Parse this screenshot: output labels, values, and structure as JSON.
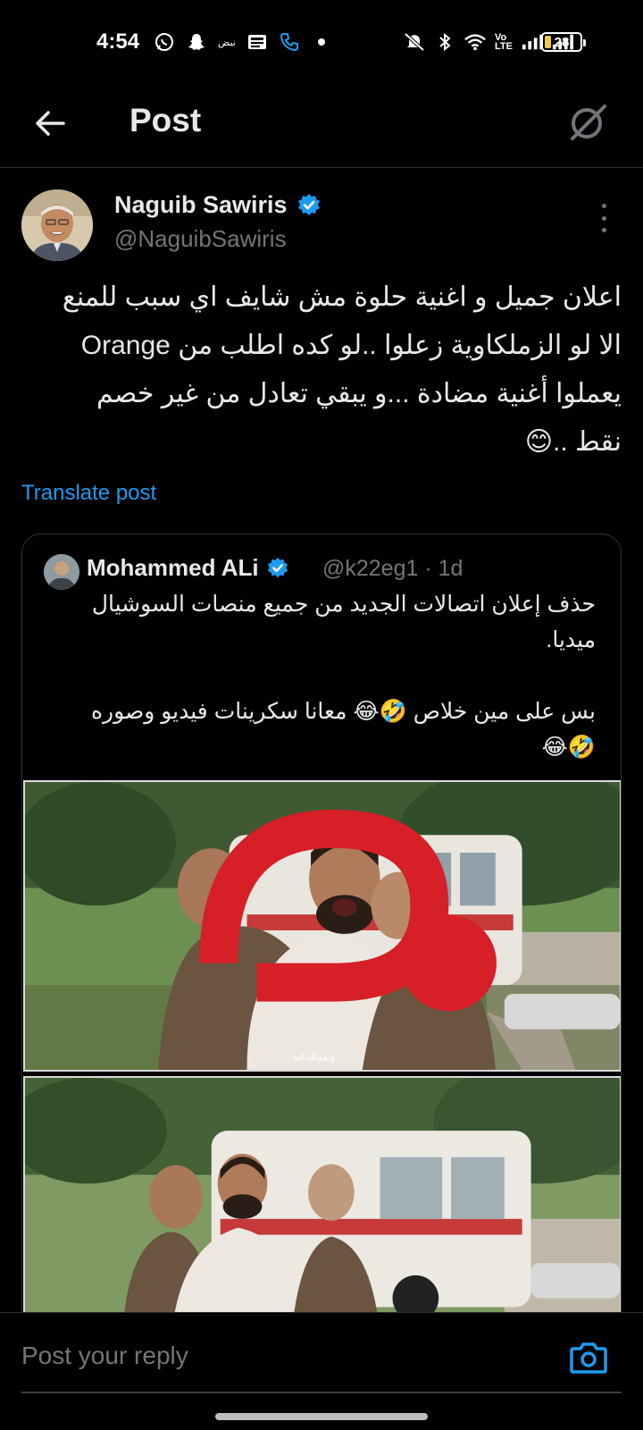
{
  "status_bar": {
    "time": "4:54",
    "carrier_label": "نبض",
    "volte_label": "Vo LTE",
    "battery_level": "28",
    "icons": [
      "whatsapp-icon",
      "snapchat-icon",
      "news-icon",
      "phone-icon",
      "dot-icon",
      "mute-icon",
      "bluetooth-icon",
      "wifi-icon",
      "signal-icon",
      "signal-icon",
      "battery-icon"
    ]
  },
  "header": {
    "title": "Post",
    "back_icon": "arrow-left-icon",
    "grok_icon": "grok-icon"
  },
  "post": {
    "author_name": "Naguib Sawiris",
    "author_handle": "@NaguibSawiris",
    "verified": true,
    "text": "اعلان جميل و اغنية حلوة مش شايف اي سبب للمنع\nالا لو الزملكاوية زعلوا ..لو كده اطلب من Orange\nيعملوا أغنية مضادة ...و يبقي تعادل من غير خصم\nنقط ..😊",
    "translate_label": "Translate post"
  },
  "quote": {
    "author_name": "Mohammed ALi",
    "author_handle": "@k22eg1 · 1d",
    "verified": true,
    "text": "حذف إعلان اتصالات الجديد من جميع منصات السوشيال\nميديا.\n\nبس على مين خلاص 🤣😂 معانا سكرينات فيديو وصوره\n🤣😂",
    "media": [
      {
        "caption": "ونقولك ايه"
      },
      {
        "caption": ""
      }
    ]
  },
  "reply": {
    "placeholder": "Post your reply",
    "camera_icon": "camera-icon"
  },
  "colors": {
    "accent": "#1d9bf0",
    "background": "#000000",
    "text": "#e7e9ea",
    "secondary": "#71767b",
    "border": "#2f3336"
  }
}
